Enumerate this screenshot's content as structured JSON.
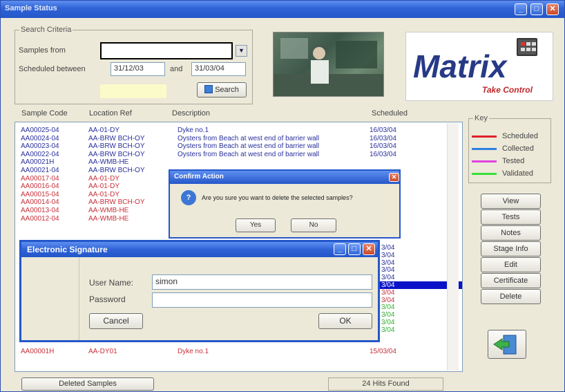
{
  "window": {
    "title": "Sample Status"
  },
  "criteria": {
    "legend": "Search Criteria",
    "samples_from_label": "Samples from",
    "samples_from_value": "",
    "scheduled_label": "Scheduled between",
    "date_from": "31/12/03",
    "and_label": "and",
    "date_to": "31/03/04",
    "search_button": "Search"
  },
  "logo": {
    "name": "Matrix",
    "tagline": "Take Control"
  },
  "columns": [
    "Sample Code",
    "Location Ref",
    "Description",
    "Scheduled"
  ],
  "rows": [
    {
      "code": "AA00025-04",
      "loc": "AA-01-DY",
      "desc": "Dyke no.1",
      "sched": "16/03/04",
      "status": "collected"
    },
    {
      "code": "AA00024-04",
      "loc": "AA-BRW BCH-OY",
      "desc": "Oysters from Beach at west end of barrier wall",
      "sched": "16/03/04",
      "status": "collected"
    },
    {
      "code": "AA00023-04",
      "loc": "AA-BRW BCH-OY",
      "desc": "Oysters from Beach at west end of barrier wall",
      "sched": "16/03/04",
      "status": "collected"
    },
    {
      "code": "AA00022-04",
      "loc": "AA-BRW BCH-OY",
      "desc": "Oysters from Beach at west end of barrier wall",
      "sched": "16/03/04",
      "status": "collected"
    },
    {
      "code": "AA00021H",
      "loc": "AA-WMB-HE",
      "desc": "",
      "sched": "",
      "status": "collected"
    },
    {
      "code": "AA00021-04",
      "loc": "AA-BRW BCH-OY",
      "desc": "",
      "sched": "",
      "status": "collected"
    },
    {
      "code": "AA00017-04",
      "loc": "AA-01-DY",
      "desc": "",
      "sched": "",
      "status": "scheduled"
    },
    {
      "code": "AA00016-04",
      "loc": "AA-01-DY",
      "desc": "",
      "sched": "",
      "status": "scheduled"
    },
    {
      "code": "AA00015-04",
      "loc": "AA-01-DY",
      "desc": "",
      "sched": "",
      "status": "scheduled"
    },
    {
      "code": "AA00014-04",
      "loc": "AA-BRW BCH-OY",
      "desc": "",
      "sched": "",
      "status": "scheduled"
    },
    {
      "code": "AA00013-04",
      "loc": "AA-WMB-HE",
      "desc": "",
      "sched": "",
      "status": "scheduled"
    },
    {
      "code": "AA00012-04",
      "loc": "AA-WMB-HE",
      "desc": "",
      "sched": "",
      "status": "scheduled"
    }
  ],
  "hidden_sched": [
    "3/04",
    "3/04",
    "3/04",
    "3/04",
    "3/04",
    "3/04",
    "3/04",
    "3/04",
    "3/04",
    "3/04",
    "3/04",
    "3/04"
  ],
  "last_row": {
    "code": "AA00001H",
    "loc": "AA-DY01",
    "desc": "Dyke no.1",
    "sched": "15/03/04"
  },
  "key": {
    "legend": "Key",
    "items": [
      {
        "label": "Scheduled",
        "color": "#e0202a"
      },
      {
        "label": "Collected",
        "color": "#2f7fe0"
      },
      {
        "label": "Tested",
        "color": "#e040e0"
      },
      {
        "label": "Validated",
        "color": "#38e038"
      }
    ]
  },
  "side_buttons": [
    "View",
    "Tests",
    "Notes",
    "Stage Info",
    "Edit",
    "Certificate",
    "Delete"
  ],
  "status": {
    "deleted_samples": "Deleted Samples",
    "hits": "24 Hits Found"
  },
  "confirm": {
    "title": "Confirm Action",
    "message": "Are you sure you want to delete the selected samples?",
    "yes": "Yes",
    "no": "No"
  },
  "esig": {
    "title": "Electronic Signature",
    "user_label": "User Name:",
    "user_value": "simon",
    "password_label": "Password",
    "password_value": "",
    "cancel": "Cancel",
    "ok": "OK"
  }
}
